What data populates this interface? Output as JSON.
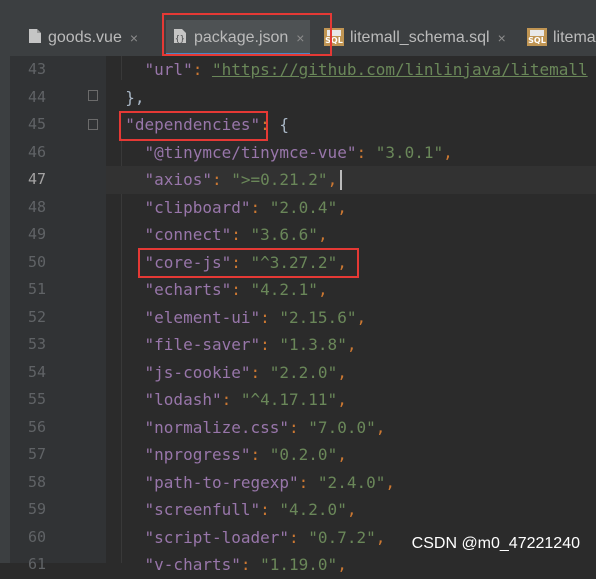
{
  "tabs": [
    {
      "label": "goods.vue",
      "icon": "vue-file-icon",
      "active": false
    },
    {
      "label": "package.json",
      "icon": "json-file-icon",
      "active": true
    },
    {
      "label": "litemall_schema.sql",
      "icon": "sql-file-icon",
      "active": false
    },
    {
      "label": "litema",
      "icon": "sql-file-icon",
      "active": false
    }
  ],
  "tab_close_glyph": "×",
  "sql_badge_text": "SQL",
  "current_line": "47",
  "lines": [
    {
      "num": "43"
    },
    {
      "num": "44"
    },
    {
      "num": "45"
    },
    {
      "num": "46"
    },
    {
      "num": "47"
    },
    {
      "num": "48"
    },
    {
      "num": "49"
    },
    {
      "num": "50"
    },
    {
      "num": "51"
    },
    {
      "num": "52"
    },
    {
      "num": "53"
    },
    {
      "num": "54"
    },
    {
      "num": "55"
    },
    {
      "num": "56"
    },
    {
      "num": "57"
    },
    {
      "num": "58"
    },
    {
      "num": "59"
    },
    {
      "num": "60"
    },
    {
      "num": "61"
    }
  ],
  "code": {
    "l43": {
      "key": "\"url\"",
      "value": "\"https://github.com/linlinjava/litemall"
    },
    "l44": {
      "text": "},"
    },
    "l45": {
      "key": "\"dependencies\"",
      "brace": "{"
    },
    "deps": [
      {
        "key": "\"@tinymce/tinymce-vue\"",
        "value": "\"3.0.1\""
      },
      {
        "key": "\"axios\"",
        "value": "\">=0.21.2\""
      },
      {
        "key": "\"clipboard\"",
        "value": "\"2.0.4\""
      },
      {
        "key": "\"connect\"",
        "value": "\"3.6.6\""
      },
      {
        "key": "\"core-js\"",
        "value": "\"^3.27.2\""
      },
      {
        "key": "\"echarts\"",
        "value": "\"4.2.1\""
      },
      {
        "key": "\"element-ui\"",
        "value": "\"2.15.6\""
      },
      {
        "key": "\"file-saver\"",
        "value": "\"1.3.8\""
      },
      {
        "key": "\"js-cookie\"",
        "value": "\"2.2.0\""
      },
      {
        "key": "\"lodash\"",
        "value": "\"^4.17.11\""
      },
      {
        "key": "\"normalize.css\"",
        "value": "\"7.0.0\""
      },
      {
        "key": "\"nprogress\"",
        "value": "\"0.2.0\""
      },
      {
        "key": "\"path-to-regexp\"",
        "value": "\"2.4.0\""
      },
      {
        "key": "\"screenfull\"",
        "value": "\"4.2.0\""
      },
      {
        "key": "\"script-loader\"",
        "value": "\"0.7.2\""
      },
      {
        "key": "\"v-charts\"",
        "value": "\"1.19.0\""
      }
    ]
  },
  "watermark": "CSDN @m0_47221240",
  "colors": {
    "key": "#9876aa",
    "string": "#6a8759",
    "punct": "#cc7832",
    "highlight_box": "#e53935",
    "tab_underline": "#4a88c7"
  }
}
